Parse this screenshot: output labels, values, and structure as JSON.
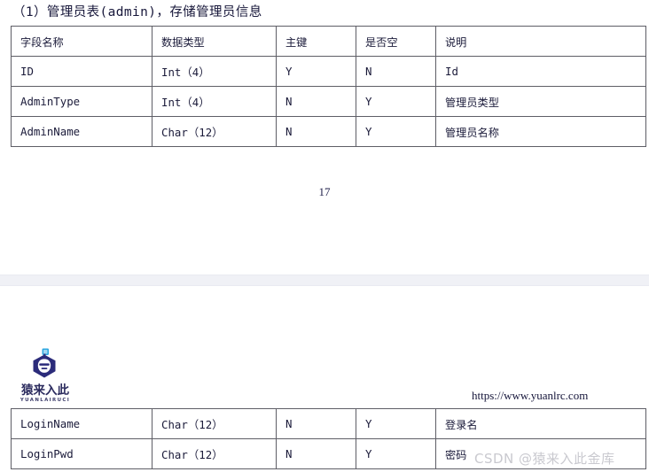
{
  "document": {
    "section_title": "（1）管理员表(admin)，存储管理员信息",
    "page_number": "17"
  },
  "table": {
    "name": "admin",
    "columns": [
      {
        "key": "field",
        "label": "字段名称"
      },
      {
        "key": "type",
        "label": "数据类型"
      },
      {
        "key": "pk",
        "label": "主键"
      },
      {
        "key": "null",
        "label": "是否空"
      },
      {
        "key": "desc",
        "label": "说明"
      }
    ],
    "rows_page1": [
      {
        "field": "ID",
        "type": "Int（4）",
        "pk": "Y",
        "null": "N",
        "desc": "Id"
      },
      {
        "field": "AdminType",
        "type": "Int（4）",
        "pk": "N",
        "null": "Y",
        "desc": "管理员类型"
      },
      {
        "field": "AdminName",
        "type": "Char（12）",
        "pk": "N",
        "null": "Y",
        "desc": "管理员名称"
      }
    ],
    "rows_page2": [
      {
        "field": "LoginName",
        "type": "Char（12）",
        "pk": "N",
        "null": "Y",
        "desc": "登录名"
      },
      {
        "field": "LoginPwd",
        "type": "Char（12）",
        "pk": "N",
        "null": "Y",
        "desc": "密码"
      }
    ]
  },
  "branding": {
    "logo_cn": "猿来入此",
    "logo_en": "YUANLAIRUCI",
    "logo_icon": "monkey-shield-icon",
    "site_url": "https://www.yuanlrc.com",
    "watermark": "CSDN @猿来入此金库",
    "logo_color": "#2b2b7a",
    "logo_accent": "#2ea7e0"
  }
}
